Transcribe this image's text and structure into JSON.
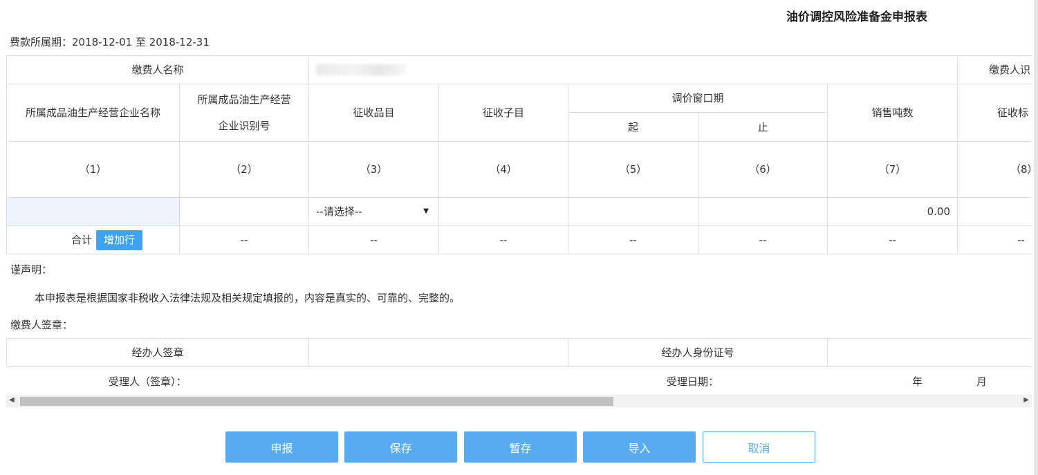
{
  "title": "油价调控风险准备金申报表",
  "period_label": "费款所属期：2018-12-01 至 2018-12-31",
  "payer": {
    "name_label": "缴费人名称",
    "id_label_partial": "缴费人识"
  },
  "headers": {
    "col1": "所属成品油生产经营企业名称",
    "col2_line1": "所属成品油生产经营",
    "col2_line2": "企业识别号",
    "col3": "征收品目",
    "col4": "征收子目",
    "window": "调价窗口期",
    "start": "起",
    "end": "止",
    "col7": "销售吨数",
    "col8_partial": "征收标"
  },
  "col_numbers": [
    "（1）",
    "（2）",
    "（3）",
    "（4）",
    "（5）",
    "（6）",
    "（7）",
    "（8）"
  ],
  "row": {
    "select_placeholder": "--请选择--",
    "tons_value": "0.00"
  },
  "total": {
    "label": "合计",
    "add_row": "增加行",
    "dash": "--"
  },
  "declaration": {
    "heading": "谨声明：",
    "body": "本申报表是根据国家非税收入法律法规及相关规定填报的，内容是真实的、可靠的、完整的。",
    "payer_seal": "缴费人签章："
  },
  "sign": {
    "handler_seal": "经办人签章",
    "handler_id": "经办人身份证号",
    "receiver": "受理人（签章）：",
    "receive_date": "受理日期：",
    "year": "年",
    "month": "月"
  },
  "buttons": {
    "submit": "申报",
    "save": "保存",
    "draft": "暂存",
    "import": "导入",
    "cancel": "取消"
  },
  "colors": {
    "primary": "#59abf1",
    "add_row": "#3ea2f0",
    "input_bg": "#eef4fd"
  }
}
